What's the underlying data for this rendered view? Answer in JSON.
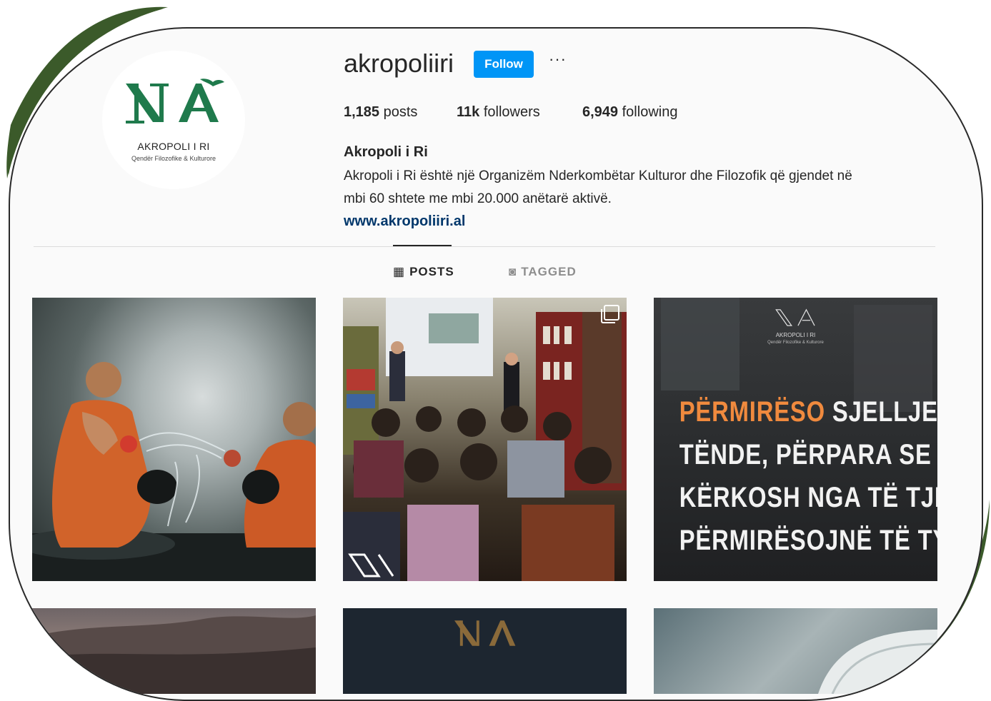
{
  "profile": {
    "username": "akropoliiri",
    "follow_label": "Follow",
    "more_label": "···",
    "avatar": {
      "logo_mark": "NA",
      "name": "AKROPOLI I RI",
      "subtitle": "Qendër Filozofike & Kulturore"
    }
  },
  "stats": {
    "posts": {
      "value": "1,185",
      "label": "posts"
    },
    "followers": {
      "value": "11k",
      "label": "followers"
    },
    "following": {
      "value": "6,949",
      "label": "following"
    }
  },
  "bio": {
    "name": "Akropoli i Ri",
    "line1": "Akropoli i Ri është një Organizëm Nderkombëtar Kulturor dhe Filozofik që gjendet në",
    "line2": "mbi 60 shtete me mbi 20.000 anëtarë aktivë.",
    "link": "www.akropoliiri.al"
  },
  "tabs": [
    {
      "label": "POSTS",
      "icon": "grid-icon",
      "glyph": "▦",
      "active": true
    },
    {
      "label": "TAGGED",
      "icon": "tagged-icon",
      "glyph": "◙",
      "active": false
    }
  ],
  "posts": {
    "p3": {
      "brand": "AKROPOLI I RI",
      "brand_sub": "Qendër Filozofike & Kulturore",
      "line1_accent": "PËRMIRËSO",
      "line1_rest": " SJELLJEN",
      "line2": "TËNDE, PËRPARA SE TË",
      "line3": "KËRKOSH NGA TË TJERËT TË",
      "line4": "PËRMIRËSOJNË TË TYREN."
    }
  },
  "colors": {
    "decor_green": "#3b5a2a",
    "follow_blue": "#0095f6",
    "link_blue": "#00376b",
    "quote_orange": "#f08a3e"
  }
}
